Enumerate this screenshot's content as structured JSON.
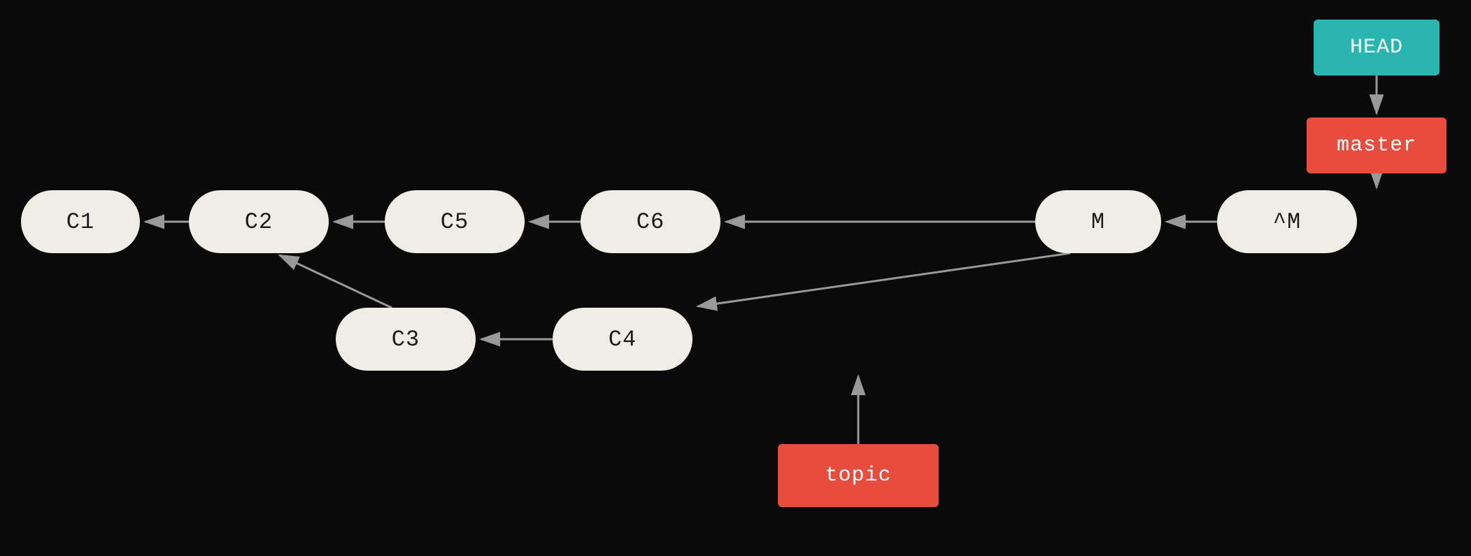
{
  "background": "#0a0a0a",
  "nodes": {
    "c1": {
      "label": "C1"
    },
    "c2": {
      "label": "C2"
    },
    "c3": {
      "label": "C3"
    },
    "c4": {
      "label": "C4"
    },
    "c5": {
      "label": "C5"
    },
    "c6": {
      "label": "C6"
    },
    "m": {
      "label": "M"
    },
    "cm": {
      "label": "^M"
    }
  },
  "branches": {
    "head": {
      "label": "HEAD"
    },
    "master": {
      "label": "master"
    },
    "topic": {
      "label": "topic"
    }
  },
  "arrows": {
    "color": "#999999"
  }
}
